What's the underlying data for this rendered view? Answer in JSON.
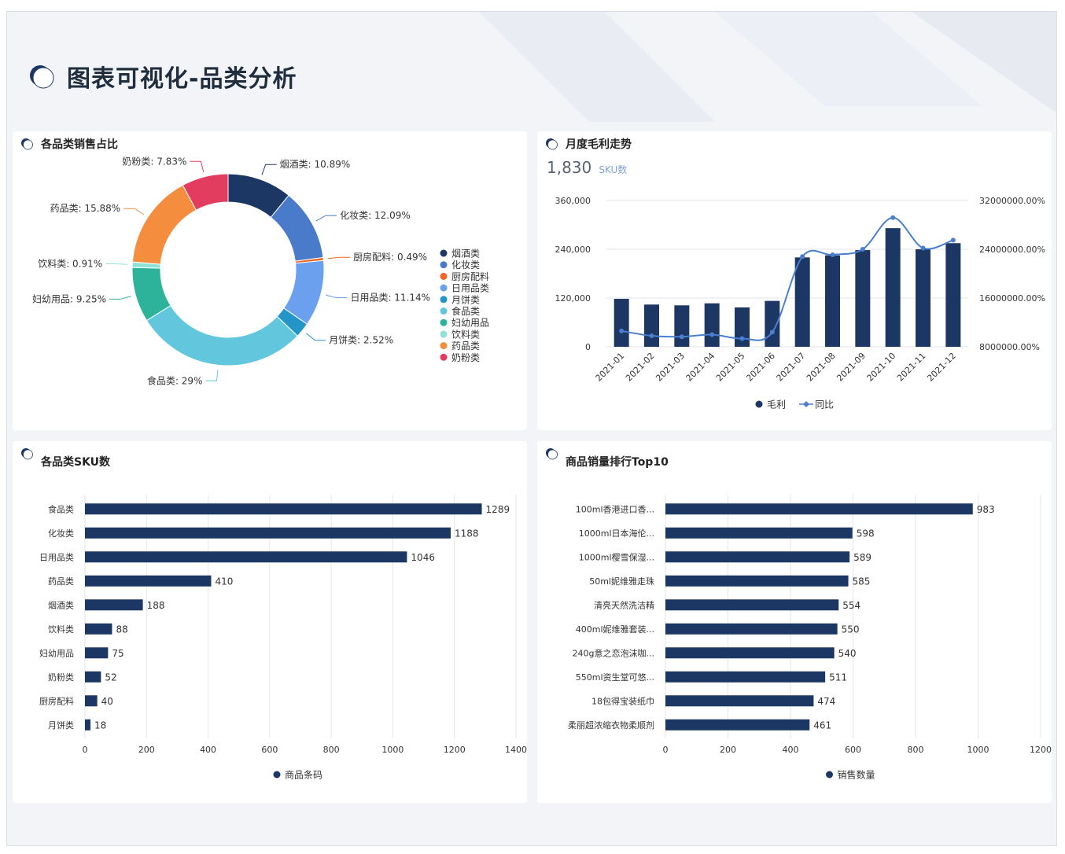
{
  "page": {
    "title": "图表可视化-品类分析"
  },
  "panels": {
    "pie": {
      "title": "各品类销售占比"
    },
    "trend": {
      "title": "月度毛利走势",
      "kpi_value": "1,830",
      "kpi_unit": "SKU数"
    },
    "sku": {
      "title": "各品类SKU数"
    },
    "top10": {
      "title": "商品销量排行Top10"
    }
  },
  "colors": {
    "navy": "#1c3763",
    "blue": "#4a7fcf",
    "bg": "#f2f4f8"
  },
  "chart_data": [
    {
      "type": "pie",
      "title": "各品类销售占比",
      "donut": true,
      "legend_position": "right",
      "slices": [
        {
          "name": "烟酒类",
          "label": "烟酒类: 10.89%",
          "value": 10.89,
          "color": "#1c3763"
        },
        {
          "name": "化妆类",
          "label": "化妆类: 12.09%",
          "value": 12.09,
          "color": "#4a7bcb"
        },
        {
          "name": "厨房配料",
          "label": "厨房配料: 0.49%",
          "value": 0.49,
          "color": "#f26522"
        },
        {
          "name": "日用品类",
          "label": "日用品类: 11.14%",
          "value": 11.14,
          "color": "#6aa0ee"
        },
        {
          "name": "月饼类",
          "label": "月饼类: 2.52%",
          "value": 2.52,
          "color": "#2495c9"
        },
        {
          "name": "食品类",
          "label": "食品类: 29%",
          "value": 29,
          "color": "#62c6dc"
        },
        {
          "name": "妇幼用品",
          "label": "妇幼用品: 9.25%",
          "value": 9.25,
          "color": "#2db39a"
        },
        {
          "name": "饮料类",
          "label": "饮料类: 0.91%",
          "value": 0.91,
          "color": "#8fe3d6"
        },
        {
          "name": "药品类",
          "label": "药品类: 15.88%",
          "value": 15.88,
          "color": "#f58d3e"
        },
        {
          "name": "奶粉类",
          "label": "奶粉类: 7.83%",
          "value": 7.83,
          "color": "#e23d5e"
        }
      ]
    },
    {
      "type": "bar",
      "title": "月度毛利走势",
      "categories": [
        "2021-01",
        "2021-02",
        "2021-03",
        "2021-04",
        "2021-05",
        "2021-06",
        "2021-07",
        "2021-08",
        "2021-09",
        "2021-10",
        "2021-11",
        "2021-12"
      ],
      "series": [
        {
          "name": "毛利",
          "type": "bar",
          "axis": "left",
          "color": "#1c3763",
          "values": [
            118000,
            104000,
            102000,
            107000,
            97000,
            113000,
            220000,
            225000,
            238000,
            292000,
            240000,
            255000
          ]
        },
        {
          "name": "同比",
          "type": "line",
          "axis": "right",
          "color": "#4a7fcf",
          "values": [
            10600000,
            9800000,
            9650000,
            10000000,
            9350000,
            10400000,
            22800000,
            23100000,
            24000000,
            29200000,
            24200000,
            25500000
          ]
        }
      ],
      "ylim_left": [
        0,
        360000
      ],
      "left_ticks": [
        "0",
        "120,000",
        "240,000",
        "360,000"
      ],
      "ylim_right": [
        8000000,
        32000000
      ],
      "right_ticks": [
        "8000000.00%",
        "16000000.00%",
        "24000000.00%",
        "32000000.00%"
      ],
      "legend": [
        "毛利",
        "同比"
      ],
      "legend_position": "bottom",
      "grid": true
    },
    {
      "type": "bar",
      "orientation": "horizontal",
      "title": "各品类SKU数",
      "categories": [
        "食品类",
        "化妆类",
        "日用品类",
        "药品类",
        "烟酒类",
        "饮料类",
        "妇幼用品",
        "奶粉类",
        "厨房配料",
        "月饼类"
      ],
      "series": [
        {
          "name": "商品条码",
          "values": [
            1289,
            1188,
            1046,
            410,
            188,
            88,
            75,
            52,
            40,
            18
          ],
          "color": "#1c3763"
        }
      ],
      "xlim": [
        0,
        1400
      ],
      "x_ticks": [
        "0",
        "200",
        "400",
        "600",
        "800",
        "1000",
        "1200",
        "1400"
      ],
      "legend_position": "bottom",
      "grid": true
    },
    {
      "type": "bar",
      "orientation": "horizontal",
      "title": "商品销量排行Top10",
      "categories": [
        "100ml香港进口香...",
        "1000ml日本海伦...",
        "1000ml樱雪保湿...",
        "50ml妮维雅走珠",
        "清亮天然洗洁精",
        "400ml妮维雅套装...",
        "240g意之恋泡沫咖...",
        "550ml资生堂可悠...",
        "18包得宝装纸巾",
        "柔丽超浓缩衣物柔顺剂"
      ],
      "series": [
        {
          "name": "销售数量",
          "values": [
            983,
            598,
            589,
            585,
            554,
            550,
            540,
            511,
            474,
            461
          ],
          "color": "#1c3763"
        }
      ],
      "xlim": [
        0,
        1200
      ],
      "x_ticks": [
        "0",
        "200",
        "400",
        "600",
        "800",
        "1000",
        "1200"
      ],
      "legend_position": "bottom",
      "grid": true
    }
  ]
}
